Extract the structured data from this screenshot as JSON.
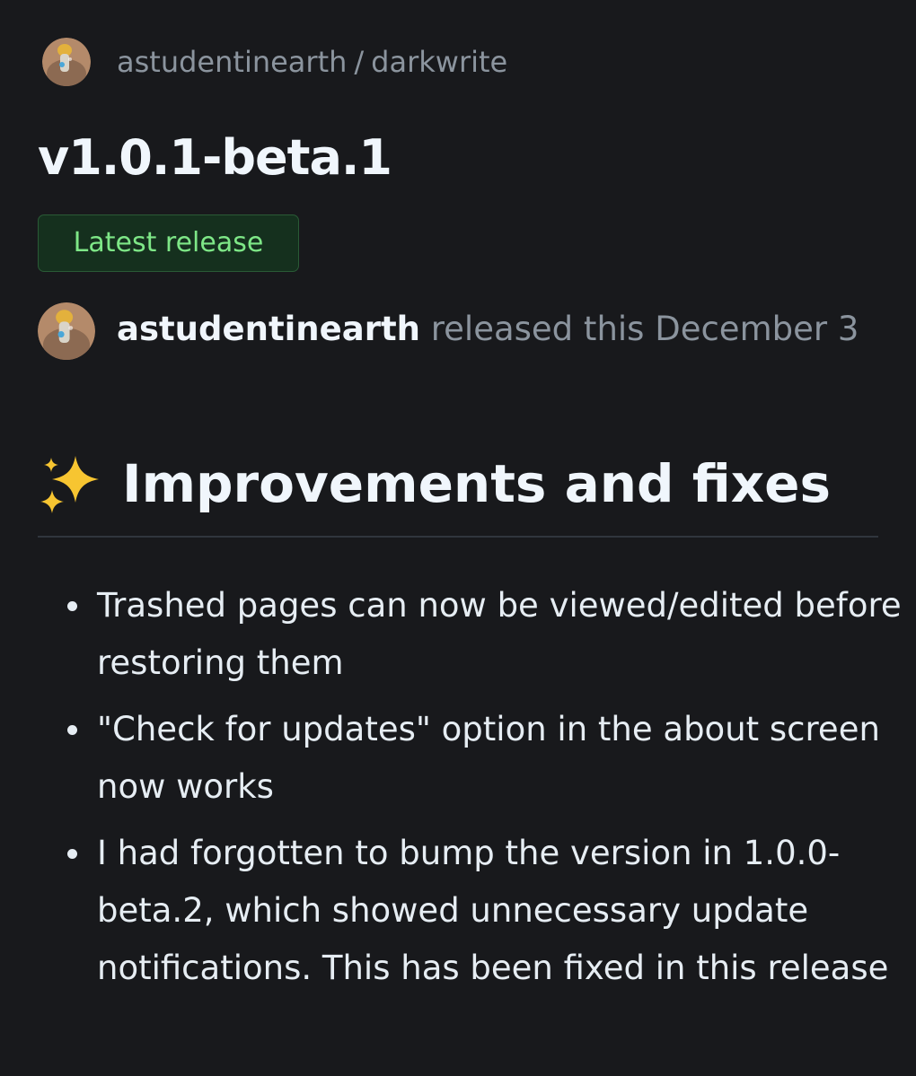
{
  "header": {
    "owner": "astudentinearth",
    "separator": "/",
    "repo": "darkwrite"
  },
  "release": {
    "title": "v1.0.1-beta.1",
    "badge": "Latest release",
    "author": "astudentinearth",
    "released_text": "released this December 3"
  },
  "notes": {
    "heading_emoji": "sparkles-icon",
    "heading": "Improvements and fixes",
    "items": [
      "Trashed pages can now be viewed/edited before restoring them",
      "\"Check for updates\" option in the about screen now works",
      "I had forgotten to bump the version in 1.0.0-beta.2, which showed unnecessary update notifications. This has been fixed in this release"
    ]
  },
  "colors": {
    "background": "#18191c",
    "muted_text": "#8b949e",
    "badge_text": "#7ee787",
    "badge_bg": "#15301e",
    "badge_border": "#2a5a36"
  }
}
